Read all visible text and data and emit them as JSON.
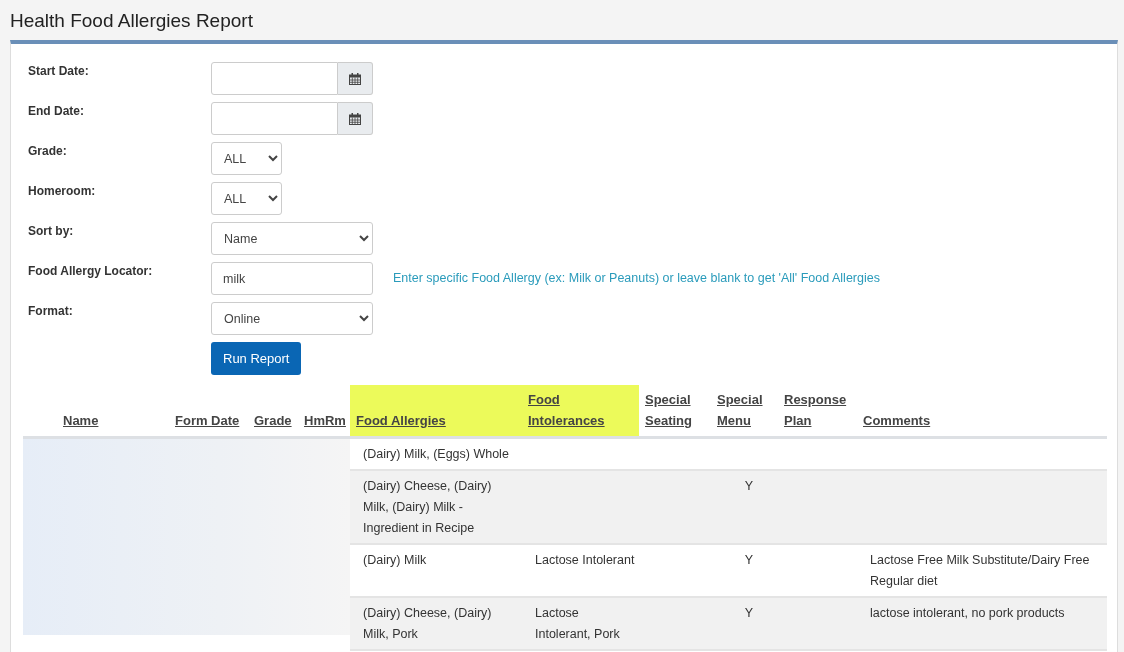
{
  "title": "Health Food Allergies Report",
  "form": [
    {
      "kind": "date",
      "label": "Start Date:"
    },
    {
      "kind": "date",
      "label": "End Date:"
    },
    {
      "kind": "small-select",
      "label": "Grade:",
      "value": "ALL"
    },
    {
      "kind": "small-select",
      "label": "Homeroom:",
      "value": "ALL"
    },
    {
      "kind": "select",
      "label": "Sort by:",
      "value": "Name"
    },
    {
      "kind": "text",
      "label": "Food Allergy Locator:",
      "value": "milk",
      "hint": "Enter specific Food Allergy (ex: Milk or Peanuts) or leave blank to get 'All' Food Allergies"
    },
    {
      "kind": "select",
      "label": "Format:",
      "value": "Online"
    }
  ],
  "run_button": "Run Report",
  "table": {
    "columns": [
      {
        "label": "Name",
        "highlighted": false
      },
      {
        "label": "Form Date",
        "highlighted": false
      },
      {
        "label": "Grade",
        "highlighted": false
      },
      {
        "label": "HmRm",
        "highlighted": false
      },
      {
        "label": "Food Allergies",
        "highlighted": true
      },
      {
        "label": "Food Intolerances",
        "highlighted": true
      },
      {
        "label": "Special Seating",
        "highlighted": false
      },
      {
        "label": "Special Menu",
        "highlighted": false
      },
      {
        "label": "Response Plan",
        "highlighted": false
      },
      {
        "label": "Comments",
        "highlighted": false
      }
    ],
    "rows": [
      {
        "food_allergies": "(Dairy) Milk, (Eggs) Whole",
        "food_intolerances": "",
        "special_seating": "",
        "special_menu": "",
        "response_plan": "",
        "comments": ""
      },
      {
        "food_allergies": "(Dairy) Cheese, (Dairy) Milk, (Dairy) Milk - Ingredient in Recipe",
        "food_intolerances": "",
        "special_seating": "",
        "special_menu": "Y",
        "response_plan": "",
        "comments": ""
      },
      {
        "food_allergies": "(Dairy) Milk",
        "food_intolerances": "Lactose Intolerant",
        "special_seating": "",
        "special_menu": "Y",
        "response_plan": "",
        "comments": "Lactose Free Milk Substitute/Dairy Free Regular diet"
      },
      {
        "food_allergies": "(Dairy) Cheese, (Dairy) Milk, Pork",
        "food_intolerances": "Lactose Intolerant, Pork",
        "special_seating": "",
        "special_menu": "Y",
        "response_plan": "",
        "comments": "lactose intolerant, no pork products"
      }
    ]
  }
}
